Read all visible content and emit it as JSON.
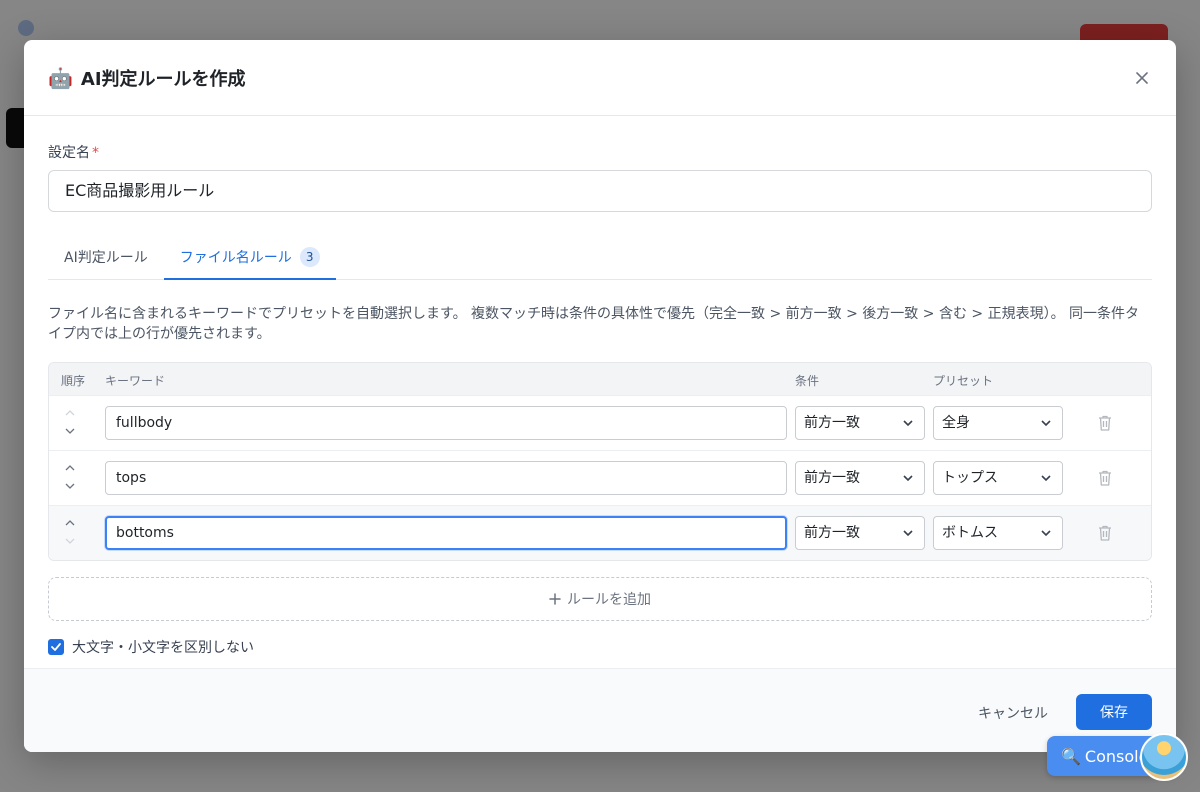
{
  "modal": {
    "title_icon": "🤖",
    "title": "AI判定ルールを作成",
    "close_icon": "close-icon"
  },
  "name_field": {
    "label": "設定名",
    "required_mark": "*",
    "value": "EC商品撮影用ルール"
  },
  "tabs": [
    {
      "label": "AI判定ルール",
      "active": false
    },
    {
      "label": "ファイル名ルール",
      "active": true,
      "badge": "3"
    }
  ],
  "description": "ファイル名に含まれるキーワードでプリセットを自動選択します。 複数マッチ時は条件の具体性で優先（完全一致 > 前方一致 > 後方一致 > 含む > 正規表現）。 同一条件タイプ内では上の行が優先されます。",
  "table": {
    "headers": {
      "order": "順序",
      "keyword": "キーワード",
      "condition": "条件",
      "preset": "プリセット"
    },
    "rows": [
      {
        "keyword": "fullbody",
        "condition": "前方一致",
        "preset": "全身"
      },
      {
        "keyword": "tops",
        "condition": "前方一致",
        "preset": "トップス"
      },
      {
        "keyword": "bottoms",
        "condition": "前方一致",
        "preset": "ボトムス"
      }
    ]
  },
  "add_rule_label": "ルールを追加",
  "case_insensitive": {
    "label": "大文字・小文字を区別しない",
    "checked": true
  },
  "footer": {
    "cancel_label": "キャンセル",
    "save_label": "保存"
  },
  "console_button": {
    "label": "Console"
  },
  "colors": {
    "primary": "#1f6fe0",
    "focus": "#3b82f6",
    "required": "#e5484d"
  }
}
